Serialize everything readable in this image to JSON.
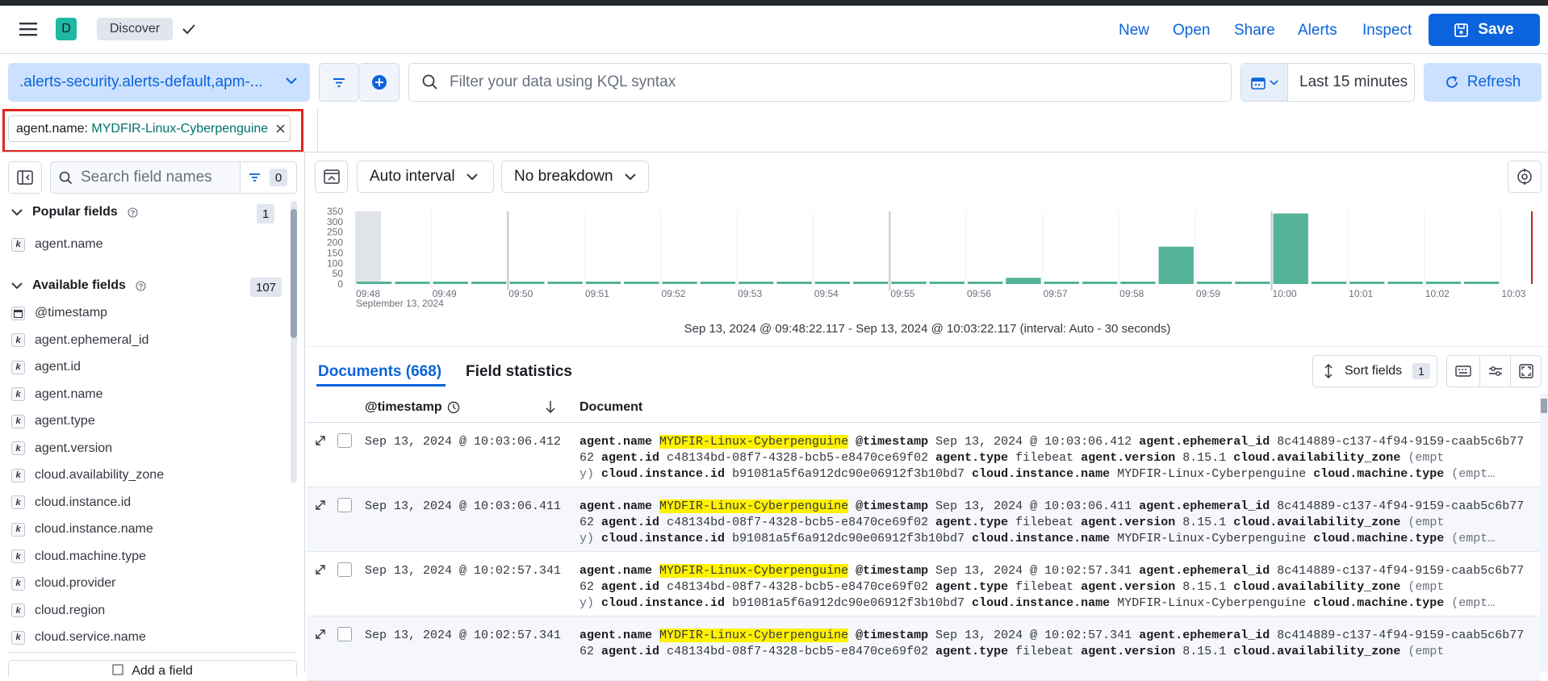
{
  "header": {
    "avatar_letter": "D",
    "app_tab": "Discover",
    "nav": [
      "New",
      "Open",
      "Share",
      "Alerts",
      "Inspect"
    ],
    "save_label": "Save"
  },
  "query": {
    "data_view": ".alerts-security.alerts-default,apm-...",
    "search_placeholder": "Filter your data using KQL syntax",
    "time_range": "Last 15 minutes",
    "refresh_label": "Refresh"
  },
  "filter": {
    "field": "agent.name: ",
    "value": "MYDFIR-Linux-Cyberpenguine"
  },
  "sidebar": {
    "search_placeholder": "Search field names",
    "filter_count": "0",
    "popular_label": "Popular fields",
    "popular_count": "1",
    "popular_fields": [
      "agent.name"
    ],
    "available_label": "Available fields",
    "available_count": "107",
    "available_fields": [
      {
        "name": "@timestamp",
        "type": "date"
      },
      {
        "name": "agent.ephemeral_id",
        "type": "keyword"
      },
      {
        "name": "agent.id",
        "type": "keyword"
      },
      {
        "name": "agent.name",
        "type": "keyword"
      },
      {
        "name": "agent.type",
        "type": "keyword"
      },
      {
        "name": "agent.version",
        "type": "keyword"
      },
      {
        "name": "cloud.availability_zone",
        "type": "keyword"
      },
      {
        "name": "cloud.instance.id",
        "type": "keyword"
      },
      {
        "name": "cloud.instance.name",
        "type": "keyword"
      },
      {
        "name": "cloud.machine.type",
        "type": "keyword"
      },
      {
        "name": "cloud.provider",
        "type": "keyword"
      },
      {
        "name": "cloud.region",
        "type": "keyword"
      },
      {
        "name": "cloud.service.name",
        "type": "keyword"
      }
    ],
    "add_field_label": "Add a field"
  },
  "chart_toolbar": {
    "interval": "Auto interval",
    "breakdown": "No breakdown"
  },
  "chart_data": {
    "type": "bar",
    "ylim": [
      0,
      350
    ],
    "yticks": [
      0,
      50,
      100,
      150,
      200,
      250,
      300,
      350
    ],
    "xticks": [
      "09:48",
      "09:49",
      "09:50",
      "09:51",
      "09:52",
      "09:53",
      "09:54",
      "09:55",
      "09:56",
      "09:57",
      "09:58",
      "09:59",
      "10:00",
      "10:01",
      "10:02",
      "10:03"
    ],
    "xsublabel": "September 13, 2024",
    "bucket_values": [
      0,
      0,
      0,
      0,
      0,
      0,
      0,
      0,
      0,
      0,
      0,
      0,
      0,
      0,
      0,
      0,
      0,
      0,
      0,
      0,
      0,
      0,
      0,
      0,
      0,
      0,
      0,
      0,
      0,
      0,
      0,
      0,
      0,
      0,
      0,
      0,
      0,
      0,
      0,
      0,
      0,
      0,
      0,
      0,
      0,
      0,
      0,
      0,
      0,
      0,
      0,
      0,
      0,
      0,
      0,
      0,
      0,
      0,
      0,
      0
    ],
    "bars": [
      {
        "time": "09:56:30",
        "value": 30
      },
      {
        "time": "09:58:30",
        "value": 180
      },
      {
        "time": "10:00:00",
        "value": 340
      }
    ],
    "caption": "Sep 13, 2024 @ 09:48:22.117 - Sep 13, 2024 @ 10:03:22.117 (interval: Auto - 30 seconds)",
    "color": "#54b399"
  },
  "docs": {
    "tab_documents": "Documents (668)",
    "tab_stats": "Field statistics",
    "sort_label": "Sort fields",
    "sort_count": "1",
    "col_timestamp": "@timestamp",
    "col_document": "Document",
    "rows": [
      {
        "ts": "Sep 13, 2024 @ 10:03:06.412",
        "name": "MYDFIR-Linux-Cyberpenguine",
        "doc_ts": "Sep 13, 2024 @ 10:03:06.412",
        "eph": "8c414889-c137-4f94-9159-caab5c6b77",
        "eph2": "62",
        "id": "c48134bd-08f7-4328-bcb5-e8470ce69f02",
        "type": "filebeat",
        "version": "8.15.1",
        "az": "(empt",
        "az2": "y)",
        "instance_id": "b91081a5f6a912dc90e06912f3b10bd7",
        "instance_name": "MYDFIR-Linux-Cyberpenguine",
        "machine": "(empt…"
      },
      {
        "ts": "Sep 13, 2024 @ 10:03:06.411",
        "name": "MYDFIR-Linux-Cyberpenguine",
        "doc_ts": "Sep 13, 2024 @ 10:03:06.411",
        "eph": "8c414889-c137-4f94-9159-caab5c6b77",
        "eph2": "62",
        "id": "c48134bd-08f7-4328-bcb5-e8470ce69f02",
        "type": "filebeat",
        "version": "8.15.1",
        "az": "(empt",
        "az2": "y)",
        "instance_id": "b91081a5f6a912dc90e06912f3b10bd7",
        "instance_name": "MYDFIR-Linux-Cyberpenguine",
        "machine": "(empt…"
      },
      {
        "ts": "Sep 13, 2024 @ 10:02:57.341",
        "name": "MYDFIR-Linux-Cyberpenguine",
        "doc_ts": "Sep 13, 2024 @ 10:02:57.341",
        "eph": "8c414889-c137-4f94-9159-caab5c6b77",
        "eph2": "62",
        "id": "c48134bd-08f7-4328-bcb5-e8470ce69f02",
        "type": "filebeat",
        "version": "8.15.1",
        "az": "(empt",
        "az2": "y)",
        "instance_id": "b91081a5f6a912dc90e06912f3b10bd7",
        "instance_name": "MYDFIR-Linux-Cyberpenguine",
        "machine": "(empt…"
      },
      {
        "ts": "Sep 13, 2024 @ 10:02:57.341",
        "name": "MYDFIR-Linux-Cyberpenguine",
        "doc_ts": "Sep 13, 2024 @ 10:02:57.341",
        "eph": "8c414889-c137-4f94-9159-caab5c6b77",
        "eph2": "62",
        "id": "c48134bd-08f7-4328-bcb5-e8470ce69f02",
        "type": "filebeat",
        "version": "8.15.1",
        "az": "(empt",
        "az2": "",
        "instance_id": "",
        "instance_name": "",
        "machine": ""
      }
    ],
    "field_labels": {
      "agent_name": "agent.name",
      "timestamp": "@timestamp",
      "eph": "agent.ephemeral_id",
      "id": "agent.id",
      "type": "agent.type",
      "version": "agent.version",
      "az": "cloud.availability_zone",
      "instance_id": "cloud.instance.id",
      "instance_name": "cloud.instance.name",
      "machine": "cloud.machine.type"
    }
  }
}
